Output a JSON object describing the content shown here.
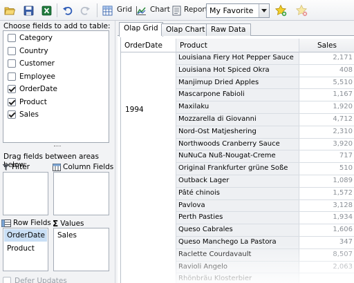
{
  "toolbar": {
    "grid_label": "Grid",
    "chart_label": "Chart",
    "report_label": "Report",
    "layout_selected": "My Favorite"
  },
  "field_panel": {
    "choose_label": "Choose fields to add to table:",
    "fields": [
      {
        "label": "Category",
        "checked": false
      },
      {
        "label": "Country",
        "checked": false
      },
      {
        "label": "Customer",
        "checked": false
      },
      {
        "label": "Employee",
        "checked": false
      },
      {
        "label": "OrderDate",
        "checked": true
      },
      {
        "label": "Product",
        "checked": true
      },
      {
        "label": "Sales",
        "checked": true
      }
    ],
    "drag_label": "Drag fields between areas below:",
    "filter_label": "Filter",
    "column_fields_label": "Column Fields",
    "row_fields_label": "Row Fields",
    "values_label": "Values",
    "row_fields": [
      "OrderDate",
      "Product"
    ],
    "values": [
      "Sales"
    ],
    "defer_label": "Defer Updates"
  },
  "tabs": [
    {
      "label": "Olap Grid",
      "active": true
    },
    {
      "label": "Olap Chart",
      "active": false
    },
    {
      "label": "Raw Data",
      "active": false
    }
  ],
  "grid": {
    "headers": {
      "orderdate": "OrderDate",
      "product": "Product",
      "sales": "Sales"
    },
    "year": "1994",
    "rows": [
      {
        "product": "Louisiana Fiery Hot Pepper Sauce",
        "sales": "2,171"
      },
      {
        "product": "Louisiana Hot Spiced Okra",
        "sales": "408"
      },
      {
        "product": "Manjimup Dried Apples",
        "sales": "5,510"
      },
      {
        "product": "Mascarpone Fabioli",
        "sales": "1,167"
      },
      {
        "product": "Maxilaku",
        "sales": "1,920"
      },
      {
        "product": "Mozzarella di Giovanni",
        "sales": "4,712"
      },
      {
        "product": "Nord-Ost Matjeshering",
        "sales": "2,310"
      },
      {
        "product": "Northwoods Cranberry Sauce",
        "sales": "3,920"
      },
      {
        "product": "NuNuCa Nuß-Nougat-Creme",
        "sales": "717"
      },
      {
        "product": "Original Frankfurter grüne Soße",
        "sales": "510"
      },
      {
        "product": "Outback Lager",
        "sales": "1,089"
      },
      {
        "product": "Pâté chinois",
        "sales": "1,572"
      },
      {
        "product": "Pavlova",
        "sales": "3,128"
      },
      {
        "product": "Perth Pasties",
        "sales": "1,934"
      },
      {
        "product": "Queso Cabrales",
        "sales": "1,606"
      },
      {
        "product": "Queso Manchego La Pastora",
        "sales": "347"
      },
      {
        "product": "Raclette Courdavault",
        "sales": "8,507"
      },
      {
        "product": "Ravioli Angelo",
        "sales": "2,063"
      },
      {
        "product": "Rhönbräu Klosterbier",
        "sales": ""
      }
    ]
  },
  "colors": {
    "accent": "#c9dff5",
    "checkmark": "#222222"
  }
}
